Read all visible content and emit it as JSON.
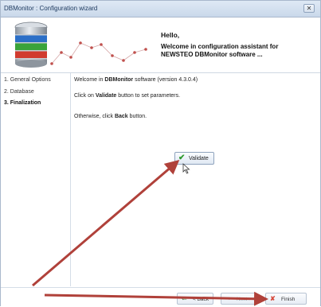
{
  "window": {
    "title": "DBMonitor : Configuration wizard",
    "close_glyph": "✕"
  },
  "header": {
    "hello": "Hello,",
    "welcome_lines": [
      "Welcome in configuration assistant for",
      "NEWSTEO DBMonitor software ..."
    ]
  },
  "sidebar": {
    "steps": [
      {
        "label": "1. General Options",
        "active": false
      },
      {
        "label": "2. Database",
        "active": false
      },
      {
        "label": "3.  Finalization",
        "active": true
      }
    ]
  },
  "content": {
    "line1_prefix": "Welcome in ",
    "line1_bold": "DBMonitor",
    "line1_suffix": " software (version 4.3.0.4)",
    "line2_prefix": "Click on ",
    "line2_bold": "Validate",
    "line2_suffix": " button to set parameters.",
    "line3_prefix": "Otherwise, click  ",
    "line3_bold": "Back",
    "line3_suffix": " button.",
    "validate_label": "Validate"
  },
  "footer": {
    "back_label": "< Back",
    "next_label": "Next >",
    "finish_label": "Finish"
  },
  "colors": {
    "arrow": "#b0413a",
    "accent": "#1e3a5f",
    "validate_check": "#2f9a2f"
  },
  "icons": {
    "header": "database-icon",
    "validate": "checkmark-icon",
    "back": "back-arrow-icon",
    "next": "next-arrow-icon",
    "finish": "cancel-x-icon"
  }
}
